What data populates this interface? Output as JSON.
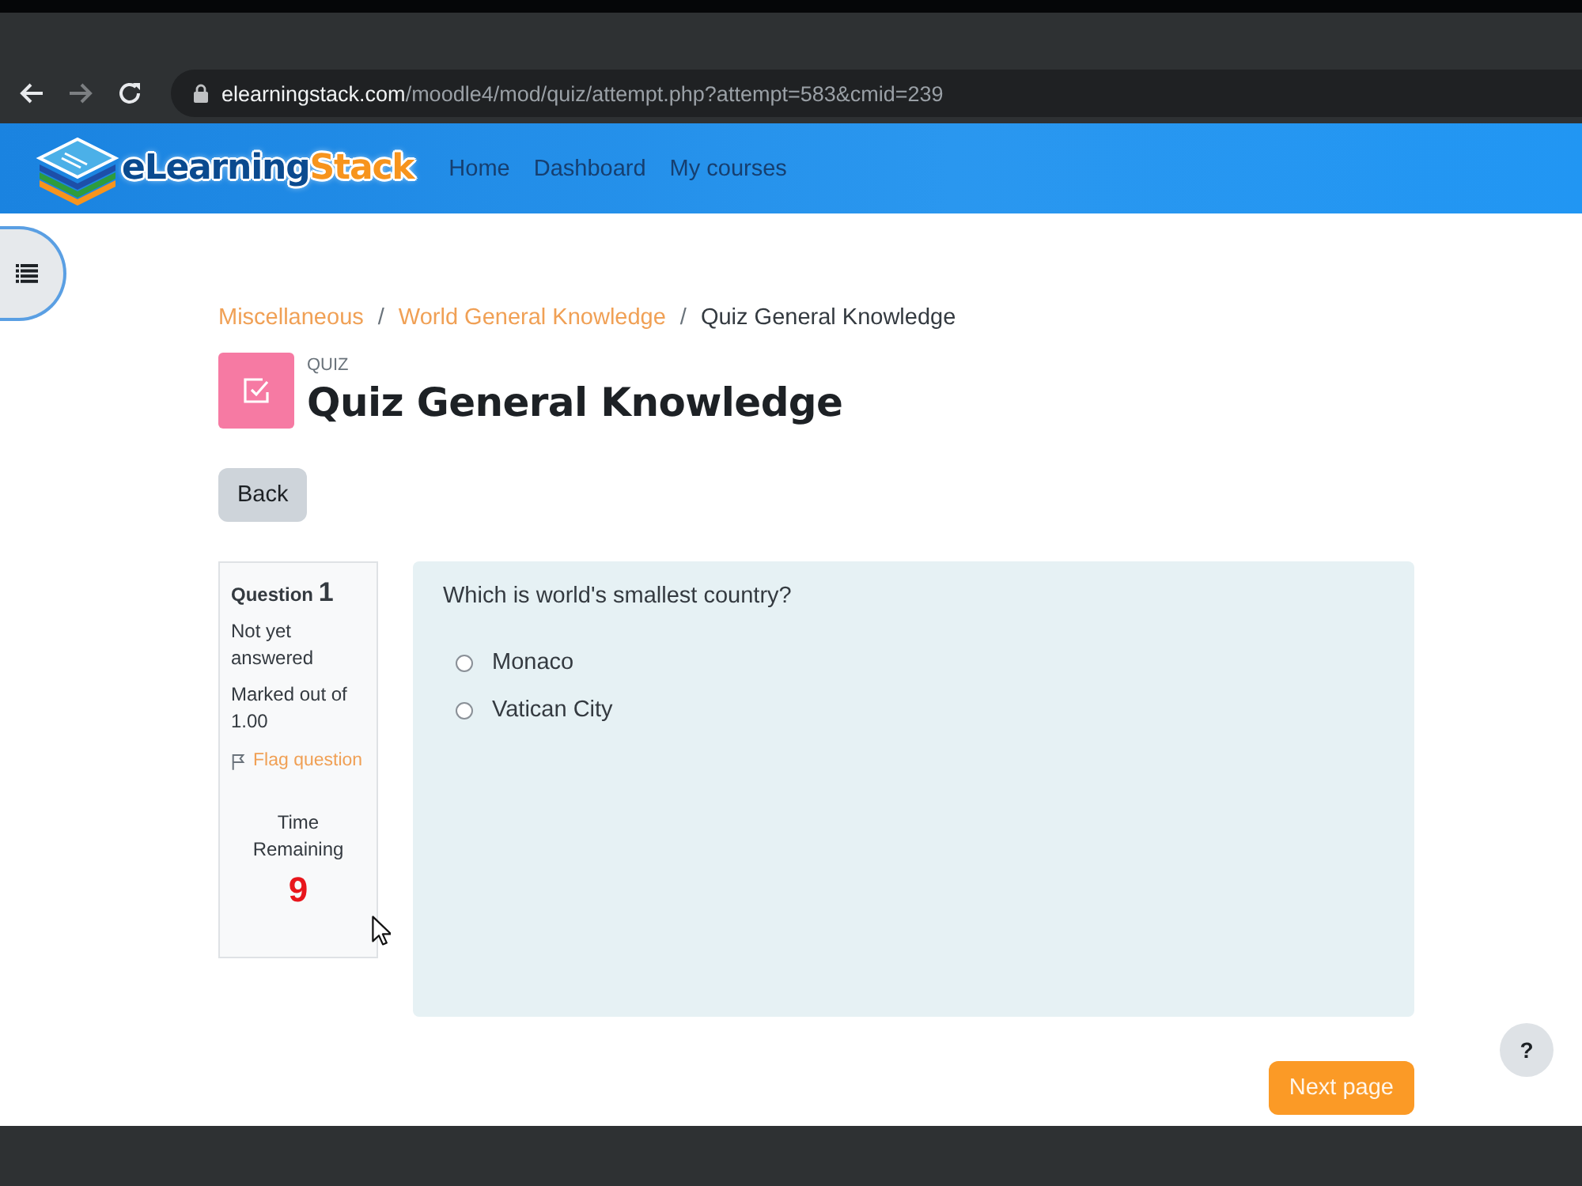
{
  "browser": {
    "nav_buttons": [
      {
        "kind": "back",
        "disabled": false
      },
      {
        "kind": "forward",
        "disabled": true
      },
      {
        "kind": "reload",
        "disabled": false
      }
    ],
    "url": {
      "host": "elearningstack.com",
      "path": "/moodle4/mod/quiz/attempt.php?attempt=583&cmid=239"
    }
  },
  "navbar": {
    "logo": {
      "text": "eLearning",
      "accent": "Stack"
    },
    "links": [
      "Home",
      "Dashboard",
      "My courses"
    ]
  },
  "breadcrumb": [
    {
      "label": "Miscellaneous",
      "kind": "link"
    },
    {
      "label": "/",
      "kind": "separator"
    },
    {
      "label": "World General Knowledge",
      "kind": "link"
    },
    {
      "label": "/",
      "kind": "separator"
    },
    {
      "label": "Quiz General Knowledge",
      "kind": "current"
    }
  ],
  "page_header": {
    "label": "QUIZ",
    "title": "Quiz General Knowledge"
  },
  "back_button": "Back",
  "question_info": {
    "label": "Question",
    "number": "1",
    "status": "Not yet answered",
    "marks": "Marked out of 1.00",
    "flag": "Flag question",
    "timer_label": "Time Remaining",
    "timer_value": "9"
  },
  "question": {
    "text": "Which is world's smallest country?",
    "options": [
      {
        "label": "Monaco",
        "selected": false
      },
      {
        "label": "Vatican City",
        "selected": false
      }
    ]
  },
  "next_button": "Next page",
  "help_button": "?"
}
